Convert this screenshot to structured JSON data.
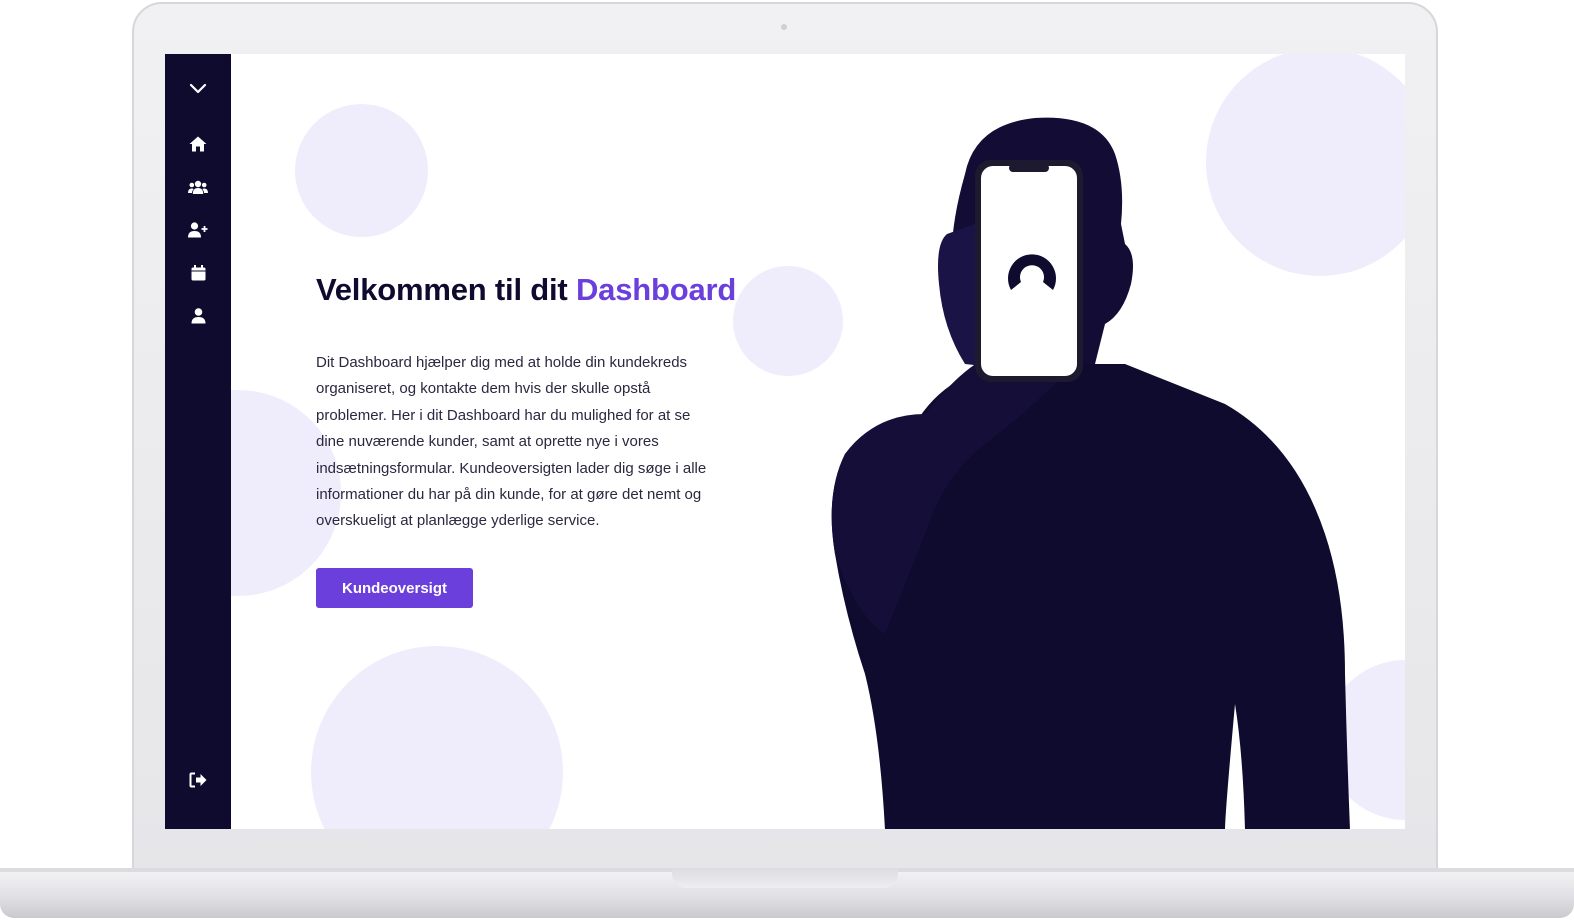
{
  "sidebar": {
    "icons": [
      {
        "name": "chevron-down-icon"
      },
      {
        "name": "home-icon"
      },
      {
        "name": "customers-icon"
      },
      {
        "name": "add-user-icon"
      },
      {
        "name": "calendar-icon"
      },
      {
        "name": "profile-icon"
      },
      {
        "name": "logout-icon"
      }
    ]
  },
  "hero": {
    "title_prefix": "Velkommen til dit",
    "title_accent": "Dashboard",
    "description": "Dit Dashboard hjælper dig med at holde din kundekreds organiseret, og kontakte dem hvis der skulle opstå problemer. Her i dit Dashboard har du mulighed for at se dine nuværende kunder, samt at oprette nye i vores indsætningsformular. Kundeoversigten lader dig søge i alle informationer du har på din kunde, for at gøre det nemt og overskueligt at planlægge yderlige service.",
    "cta_label": "Kundeoversigt"
  },
  "colors": {
    "sidebar": "#0f0b2e",
    "accent": "#6a3fdc",
    "circle": "#efedfb",
    "text": "#0f0b2e"
  }
}
